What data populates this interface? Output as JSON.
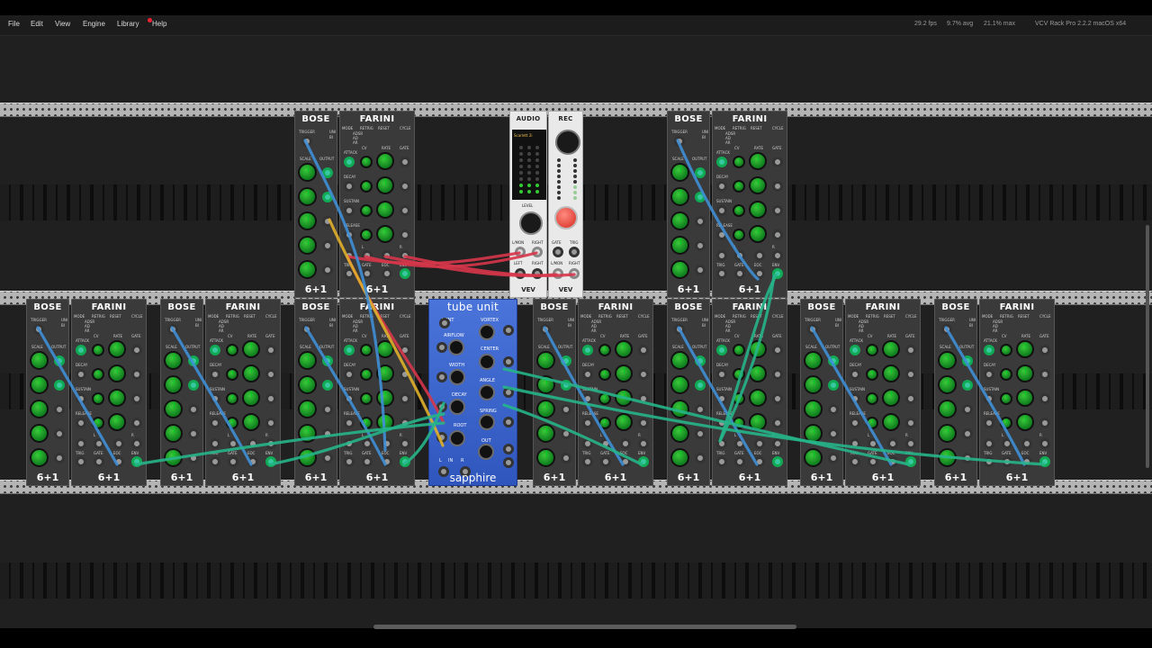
{
  "menubar": {
    "items": [
      "File",
      "Edit",
      "View",
      "Engine",
      "Library",
      "Help"
    ],
    "notification_color": "#e22233",
    "status_fps": "29.2 fps",
    "status_avg": "9.7% avg",
    "status_max": "21.1% max",
    "app_title": "VCV Rack Pro 2.2.2 macOS x64"
  },
  "modules": {
    "bose_title": "BOSE",
    "farini_title": "FARINI",
    "six_plus_one": "6+1",
    "bose_labels": {
      "trigger": "TRIGGER",
      "scale": "SCALE",
      "output": "OUTPUT",
      "uni": "UNI",
      "bi": "BI"
    },
    "farini_labels": {
      "mode": "MODE",
      "retrig": "RETRIG",
      "reset": "RESET",
      "cycle": "CYCLE",
      "adsr": "ADSR",
      "ad": "AD",
      "ar": "AR",
      "cv": "CV",
      "rate": "RATE",
      "gate": "GATE",
      "attack": "ATTACK",
      "decay": "DECAY",
      "sustain": "SUSTAIN",
      "release": "RELEASE",
      "l": "L",
      "r": "R",
      "trig": "TRIG",
      "eoc": "EOC",
      "env": "ENV"
    },
    "audio": {
      "title": "AUDIO",
      "device": "Scarlett 2i",
      "level_label": "LEVEL",
      "in_labels": [
        "L/MON",
        "RIGHT"
      ],
      "out_labels": [
        "LEFT",
        "RIGHT"
      ],
      "brand": "VEV"
    },
    "rec": {
      "title": "REC",
      "gate_label": "GATE",
      "trig_label": "TRIG",
      "in_labels": [
        "L/MON",
        "RIGHT"
      ],
      "brand": "VEV"
    },
    "tube_unit": {
      "title": "tube unit",
      "brand": "sapphire",
      "labels": [
        "VENT",
        "VORTEX",
        "AIRFLOW",
        "CENTER",
        "WIDTH",
        "ANGLE",
        "DECAY",
        "SPRING",
        "ROOT",
        "OUT",
        "IN",
        "L",
        "R"
      ]
    }
  },
  "colors": {
    "cable_red": "#d6364a",
    "cable_blue": "#3f8fd6",
    "cable_teal": "#26b58a",
    "cable_yellow": "#e0b02c",
    "knob_green": "#1fa23a",
    "tube_blue": "#4a74d9"
  }
}
